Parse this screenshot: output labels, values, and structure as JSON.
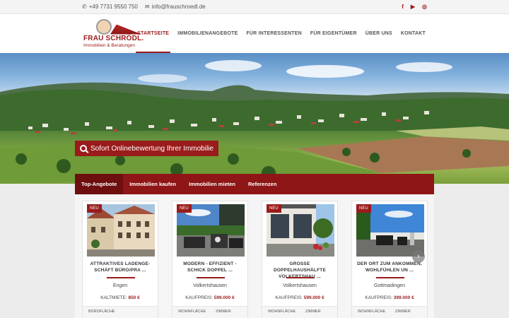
{
  "topbar": {
    "phone": "+49 7731 9550 750",
    "email": "info@frauschroedl.de",
    "social": [
      {
        "icon": "facebook-icon",
        "glyph": "f"
      },
      {
        "icon": "youtube-icon",
        "glyph": "▶"
      },
      {
        "icon": "instagram-icon",
        "glyph": "◎"
      }
    ]
  },
  "brand": {
    "name": "FRAU SCHRÖDL.",
    "tagline": "Immobilien & Beratungen"
  },
  "nav": [
    {
      "label": "STARTSEITE",
      "active": true
    },
    {
      "label": "IMMOBILIENANGEBOTE"
    },
    {
      "label": "FÜR INTERESSENTEN"
    },
    {
      "label": "FÜR EIGENTÜMER"
    },
    {
      "label": "ÜBER UNS"
    },
    {
      "label": "KONTAKT"
    }
  ],
  "hero": {
    "cta_label": "Sofort Onlinebewertung Ihrer Immobilie"
  },
  "tabs": [
    {
      "label": "Top-Angebote",
      "active": true
    },
    {
      "label": "Immobilien kaufen"
    },
    {
      "label": "Immobilien mieten"
    },
    {
      "label": "Referenzen"
    }
  ],
  "cards": [
    {
      "badge": "NEU",
      "title": "ATTRAKTIVES LADENGE-SCHÄFT BÜRO/PRA ...",
      "location": "Engen",
      "price_label": "KALTMIETE:",
      "price_value": "850 €",
      "stat1": "BÜROFLÄCHE",
      "stat2": ""
    },
    {
      "badge": "NEU",
      "title": "MODERN - EFFIZIENT - SCHICK DOPPEL ...",
      "location": "Volkertshausen",
      "price_label": "KAUFPREIS:",
      "price_value": "599.000 €",
      "stat1": "WOHNFLÄCHE",
      "stat2": "ZIMMER"
    },
    {
      "badge": "NEU",
      "title": "GROSSE DOPPELHAUSHÄLFTE VOLKERTSHAU ...",
      "location": "Volkertshausen",
      "price_label": "KAUFPREIS:",
      "price_value": "599.000 €",
      "stat1": "WOHNFLÄCHE",
      "stat2": "ZIMMER"
    },
    {
      "badge": "NEU",
      "title": "DER ORT ZUM ANKOMMEN, WOHLFÜHLEN UN ...",
      "location": "Gottmadingen",
      "price_label": "KAUFPREIS:",
      "price_value": "399.000 €",
      "stat1": "WOHNFLÄCHE",
      "stat2": "ZIMMER"
    }
  ],
  "carousel": {
    "next_glyph": "›"
  },
  "colors": {
    "brand": "#9a1b1b",
    "brand_dark": "#6e0f0f"
  }
}
